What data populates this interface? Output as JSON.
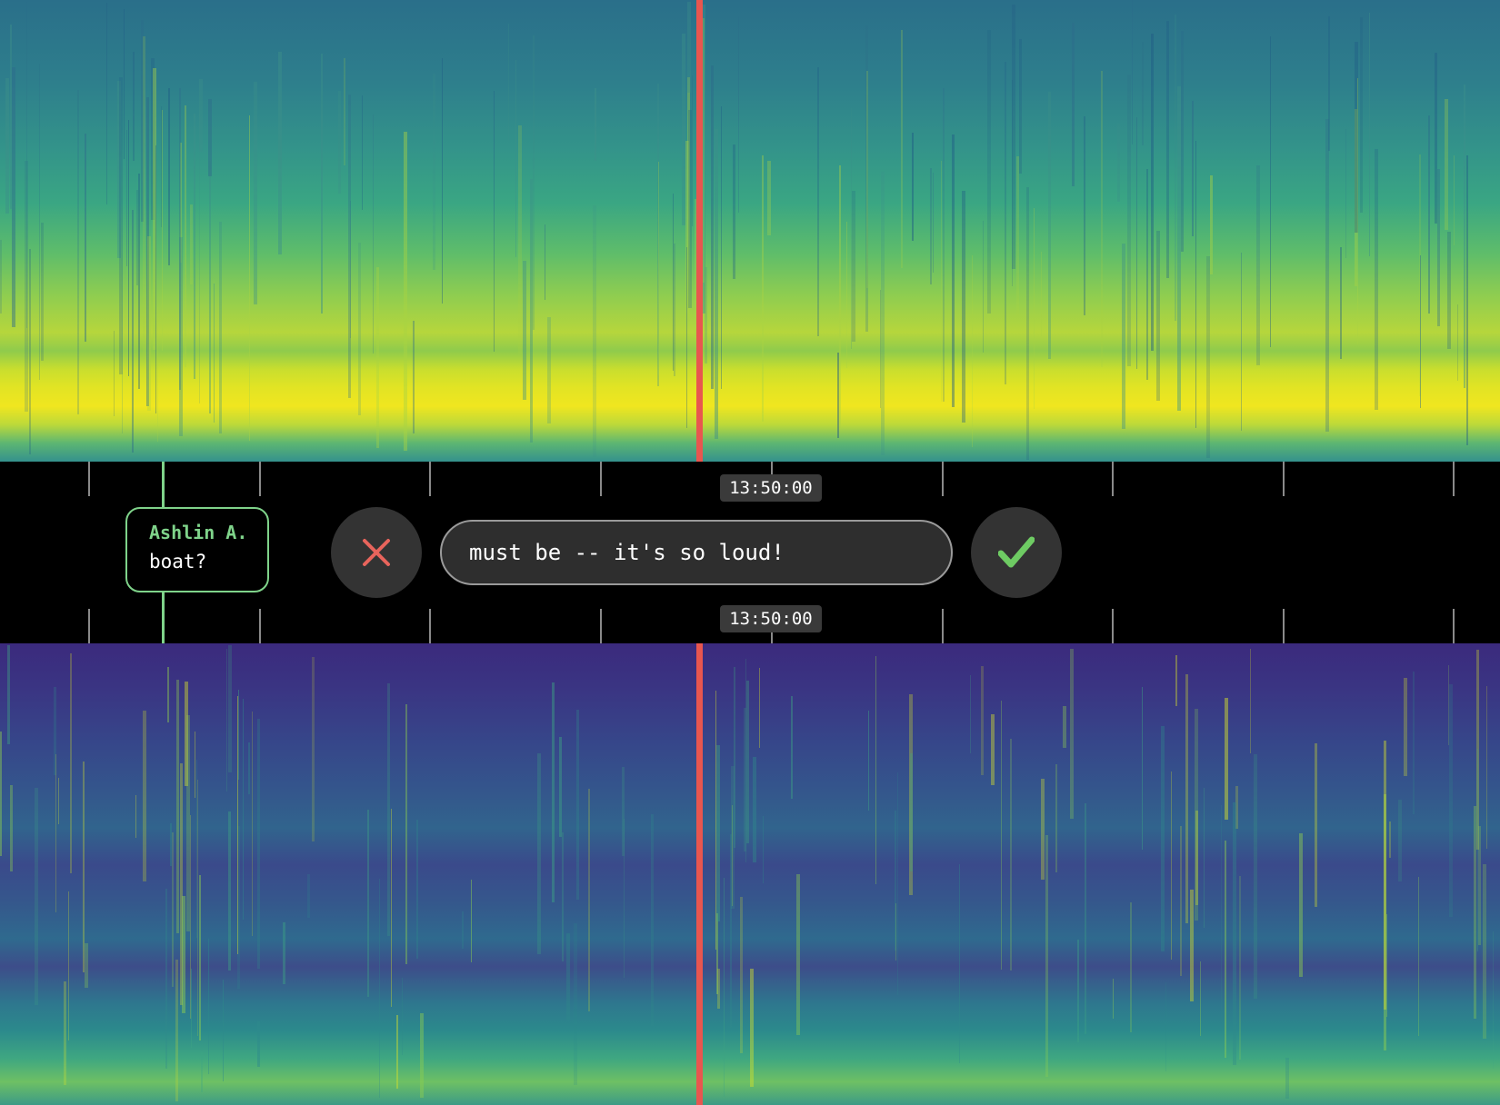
{
  "timeline": {
    "top_time_label": "13:50:00",
    "bottom_time_label": "13:50:00"
  },
  "comment": {
    "author": "Ashlin A.",
    "text": "boat?"
  },
  "reply": {
    "value": "must be -- it's so loud!"
  },
  "icons": {
    "cancel": "close-icon",
    "confirm": "checkmark-icon"
  },
  "colors": {
    "playhead": "#e8564f",
    "comment_accent": "#7fd38a",
    "cancel_icon": "#e8645c",
    "confirm_icon": "#6ecb63"
  }
}
